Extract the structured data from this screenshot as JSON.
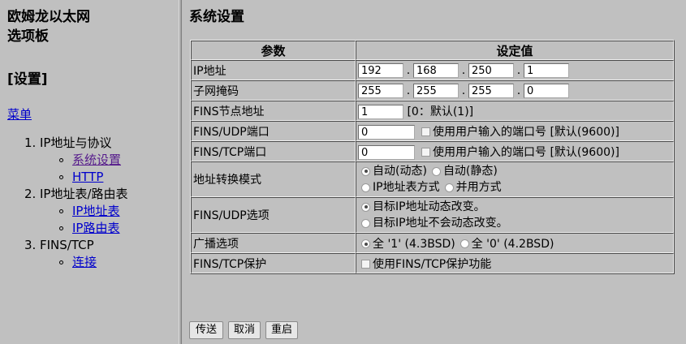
{
  "sidebar": {
    "brand_line1": "欧姆龙以太网",
    "brand_line2": "选项板",
    "settings_header": "[设置]",
    "menu_link": "菜单",
    "sections": [
      {
        "num": "1.",
        "label": "IP地址与协议",
        "items": [
          {
            "label": "系统设置"
          },
          {
            "label": "HTTP"
          }
        ]
      },
      {
        "num": "2.",
        "label": "IP地址表/路由表",
        "items": [
          {
            "label": "IP地址表"
          },
          {
            "label": "IP路由表"
          }
        ]
      },
      {
        "num": "3.",
        "label": "FINS/TCP",
        "items": [
          {
            "label": "连接"
          }
        ]
      }
    ]
  },
  "main": {
    "title": "系统设置",
    "table": {
      "header_param": "参数",
      "header_value": "设定值",
      "ip_address": {
        "label": "IP地址",
        "octets": [
          "192",
          "168",
          "250",
          "1"
        ]
      },
      "subnet_mask": {
        "label": "子网掩码",
        "octets": [
          "255",
          "255",
          "255",
          "0"
        ]
      },
      "fins_node": {
        "label": "FINS节点地址",
        "value": "1",
        "hint": "[0：默认(1)]"
      },
      "fins_udp_port": {
        "label": "FINS/UDP端口",
        "value": "0",
        "checkbox_label": "使用用户输入的端口号 [默认(9600)]",
        "checked": false
      },
      "fins_tcp_port": {
        "label": "FINS/TCP端口",
        "value": "0",
        "checkbox_label": "使用用户输入的端口号 [默认(9600)]",
        "checked": false
      },
      "addr_conversion": {
        "label": "地址转换模式",
        "options": [
          "自动(动态)",
          "自动(静态)",
          "IP地址表方式",
          "并用方式"
        ],
        "selected": 0
      },
      "fins_udp_option": {
        "label": "FINS/UDP选项",
        "options": [
          "目标IP地址动态改变。",
          "目标IP地址不会动态改变。"
        ],
        "selected": 0
      },
      "broadcast": {
        "label": "广播选项",
        "options": [
          "全 '1' (4.3BSD)",
          "全 '0' (4.2BSD)"
        ],
        "selected": 0
      },
      "fins_tcp_protect": {
        "label": "FINS/TCP保护",
        "checkbox_label": "使用FINS/TCP保护功能",
        "checked": false
      }
    },
    "buttons": {
      "send": "传送",
      "cancel": "取消",
      "restart": "重启"
    }
  }
}
